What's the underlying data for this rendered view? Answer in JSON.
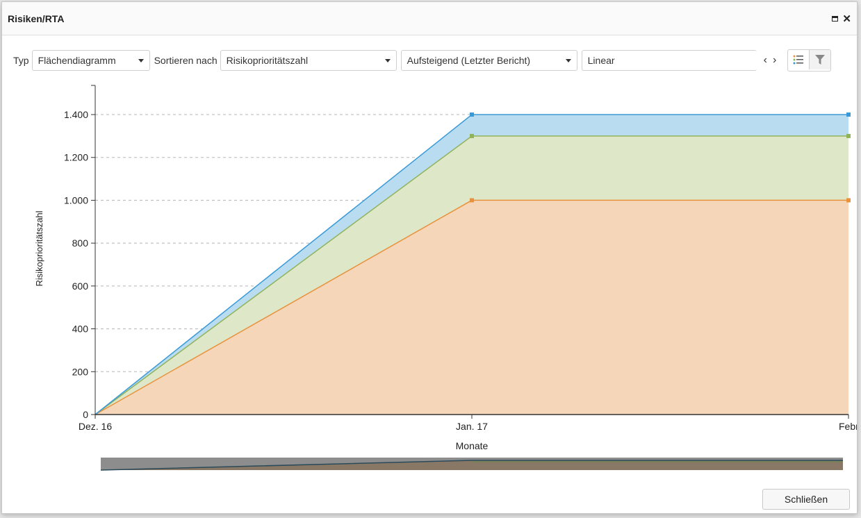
{
  "window": {
    "title": "Risiken/RTA"
  },
  "toolbar": {
    "type_label": "Typ",
    "type_value": "Flächendiagramm",
    "sort_label": "Sortieren nach",
    "sort_value": "Risikoprioritätszahl",
    "order_value": "Aufsteigend (Letzter Bericht)",
    "scale_value": "Linear",
    "prev_glyph": "‹",
    "next_glyph": "›"
  },
  "chart_data": {
    "type": "area",
    "stacked": true,
    "x": [
      "Dez. 16",
      "Jan. 17",
      "Febr"
    ],
    "xlabel": "Monate",
    "ylabel": "Risikoprioritätszahl",
    "ylim": [
      0,
      1400
    ],
    "yticks": [
      "0",
      "200",
      "400",
      "600",
      "800",
      "1.000",
      "1.200",
      "1.400"
    ],
    "yticks_values": [
      0,
      200,
      400,
      600,
      800,
      1000,
      1200,
      1400
    ],
    "grid": true,
    "series": [
      {
        "values": [
          0,
          1000,
          1000
        ],
        "color": "#f5d6b8",
        "line": "#e8923e"
      },
      {
        "values": [
          0,
          300,
          300
        ],
        "color": "#dfe7c9",
        "line": "#8fb35a"
      },
      {
        "values": [
          0,
          100,
          100
        ],
        "color": "#b9dcf0",
        "line": "#3a9ad6"
      }
    ]
  },
  "footer": {
    "close_label": "Schließen"
  }
}
